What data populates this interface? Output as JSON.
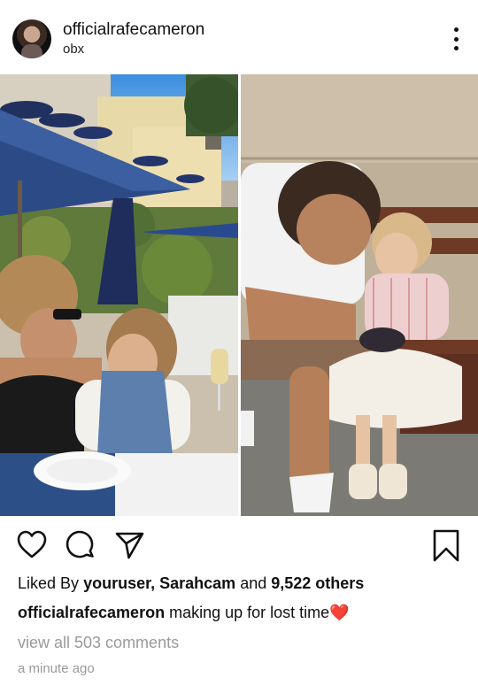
{
  "post": {
    "author": "officialrafecameron",
    "location": "obx"
  },
  "likes": {
    "prefix": "Liked By",
    "user1": "youruser,",
    "user2": "Sarahcam",
    "and": "and",
    "count": "9,522 others"
  },
  "caption": {
    "author": "officialrafecameron",
    "text": "making up for lost time",
    "emoji": "❤️"
  },
  "comments": {
    "link": "view all 503 comments"
  },
  "timestamp": "a minute ago",
  "icons": {
    "like": "heart-icon",
    "comment": "comment-icon",
    "share": "send-icon",
    "save": "bookmark-icon",
    "more": "more-options-icon"
  },
  "colors": {
    "text": "#111111",
    "muted": "#9a9a9a",
    "heart": "#e0112b"
  }
}
